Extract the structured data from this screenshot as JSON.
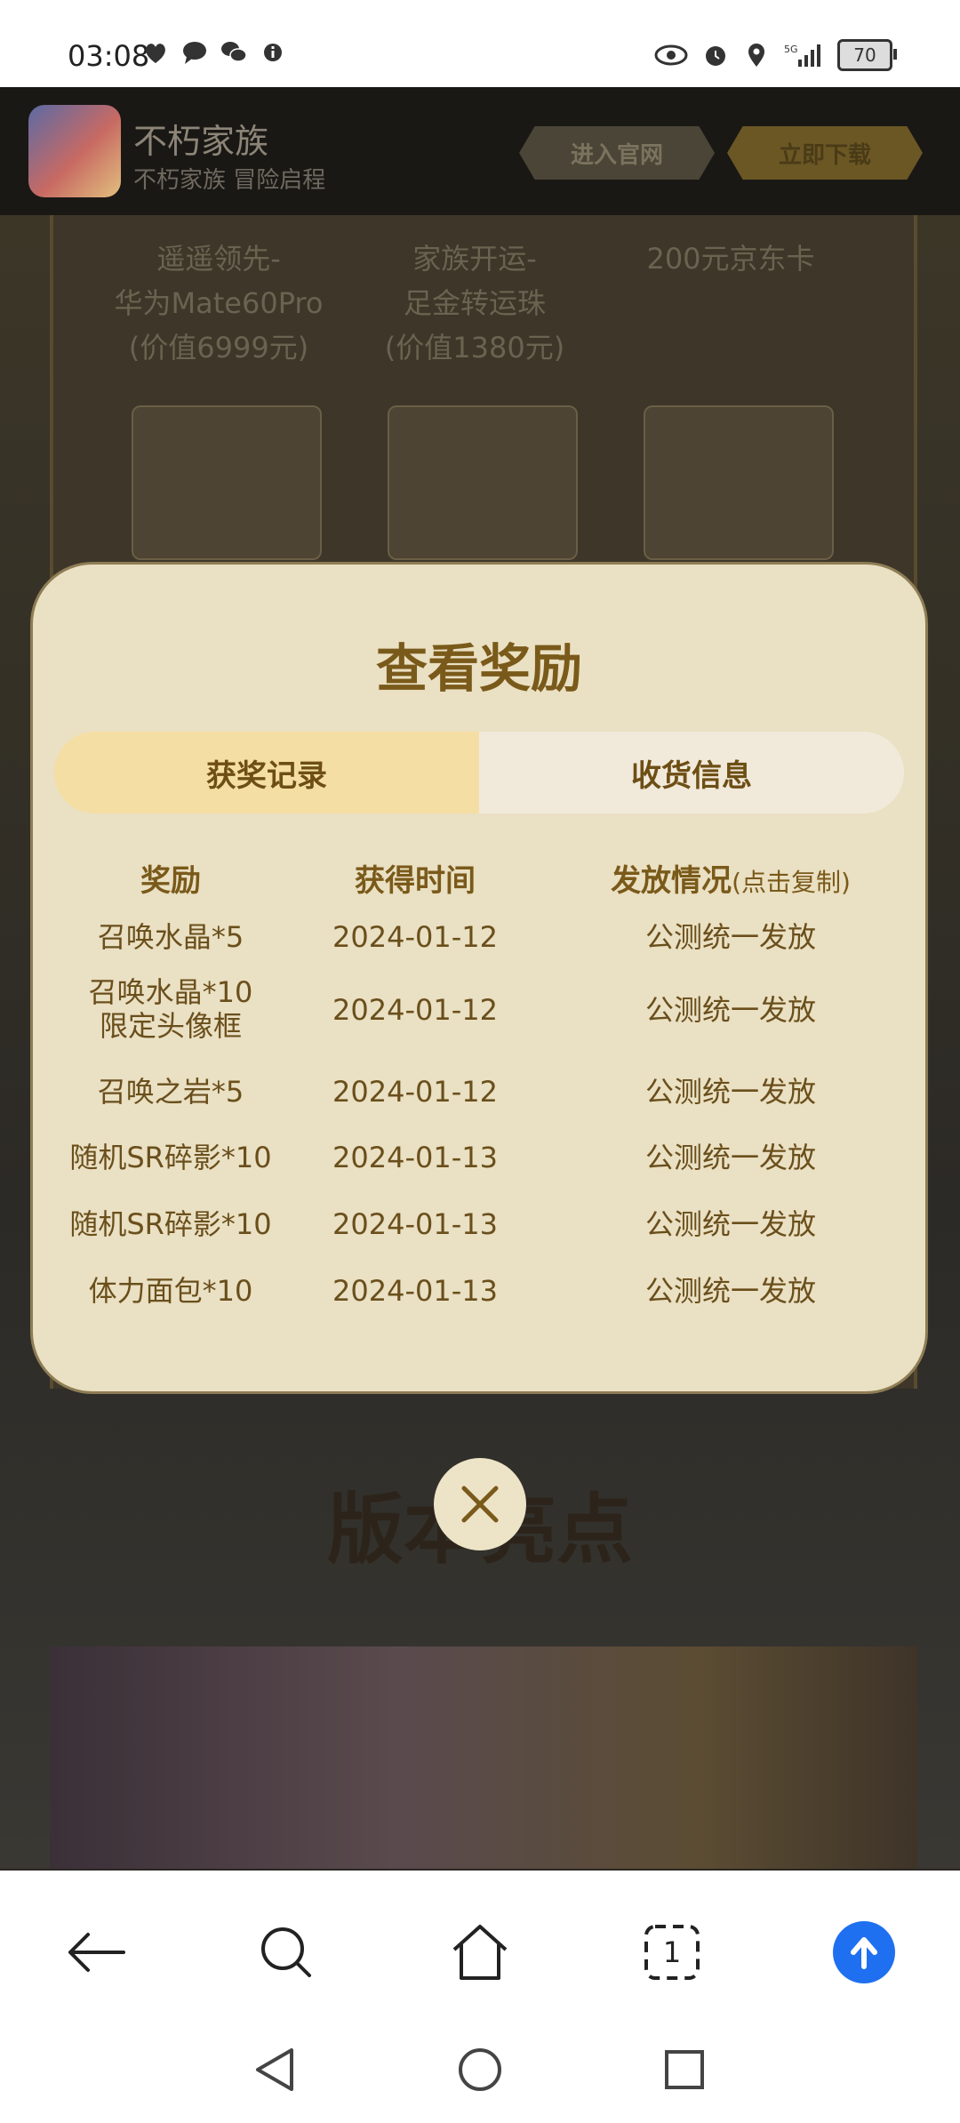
{
  "status_bar": {
    "time": "03:08",
    "battery": "70"
  },
  "app_header": {
    "name": "不朽家族",
    "subtitle": "不朽家族 冒险启程",
    "official_site_label": "进入官网",
    "download_label": "立即下载"
  },
  "background": {
    "prizes": [
      {
        "line1": "遥遥领先-",
        "line2": "华为Mate60Pro",
        "line3": "(价值6999元)"
      },
      {
        "line1": "家族开运-",
        "line2": "足金转运珠",
        "line3": "(价值1380元)"
      },
      {
        "line1": "200元京东卡",
        "line2": "",
        "line3": ""
      }
    ],
    "version_title": "版本亮点"
  },
  "modal": {
    "title": "查看奖励",
    "tabs": [
      {
        "label": "获奖记录",
        "active": true
      },
      {
        "label": "收货信息",
        "active": false
      }
    ],
    "columns": {
      "reward": "奖励",
      "time": "获得时间",
      "status": "发放情况",
      "status_hint": "(点击复制)"
    },
    "rows": [
      {
        "reward": "召唤水晶*5",
        "reward2": "",
        "time": "2024-01-12",
        "status": "公测统一发放"
      },
      {
        "reward": "召唤水晶*10",
        "reward2": "限定头像框",
        "time": "2024-01-12",
        "status": "公测统一发放"
      },
      {
        "reward": "召唤之岩*5",
        "reward2": "",
        "time": "2024-01-12",
        "status": "公测统一发放"
      },
      {
        "reward": "随机SR碎影*10",
        "reward2": "",
        "time": "2024-01-13",
        "status": "公测统一发放"
      },
      {
        "reward": "随机SR碎影*10",
        "reward2": "",
        "time": "2024-01-13",
        "status": "公测统一发放"
      },
      {
        "reward": "体力面包*10",
        "reward2": "",
        "time": "2024-01-13",
        "status": "公测统一发放"
      }
    ]
  },
  "browser": {
    "tab_count": "1"
  },
  "colors": {
    "accent": "#7a5a1a",
    "modal_bg": "#eae0c3",
    "tab_active": "#f5dea3",
    "upload_blue": "#1f70f0"
  }
}
